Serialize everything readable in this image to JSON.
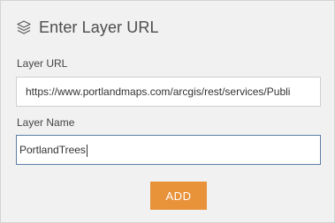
{
  "header": {
    "title": "Enter Layer URL",
    "icon": "layers-icon"
  },
  "layer_url": {
    "label": "Layer URL",
    "value": "https://www.portlandmaps.com/arcgis/rest/services/Publi"
  },
  "layer_name": {
    "label": "Layer Name",
    "value": "PortlandTrees"
  },
  "actions": {
    "add_label": "ADD"
  },
  "colors": {
    "accent": "#e8923a",
    "panel_bg": "#f1f1f1",
    "focus_border": "#5a7fa6"
  }
}
